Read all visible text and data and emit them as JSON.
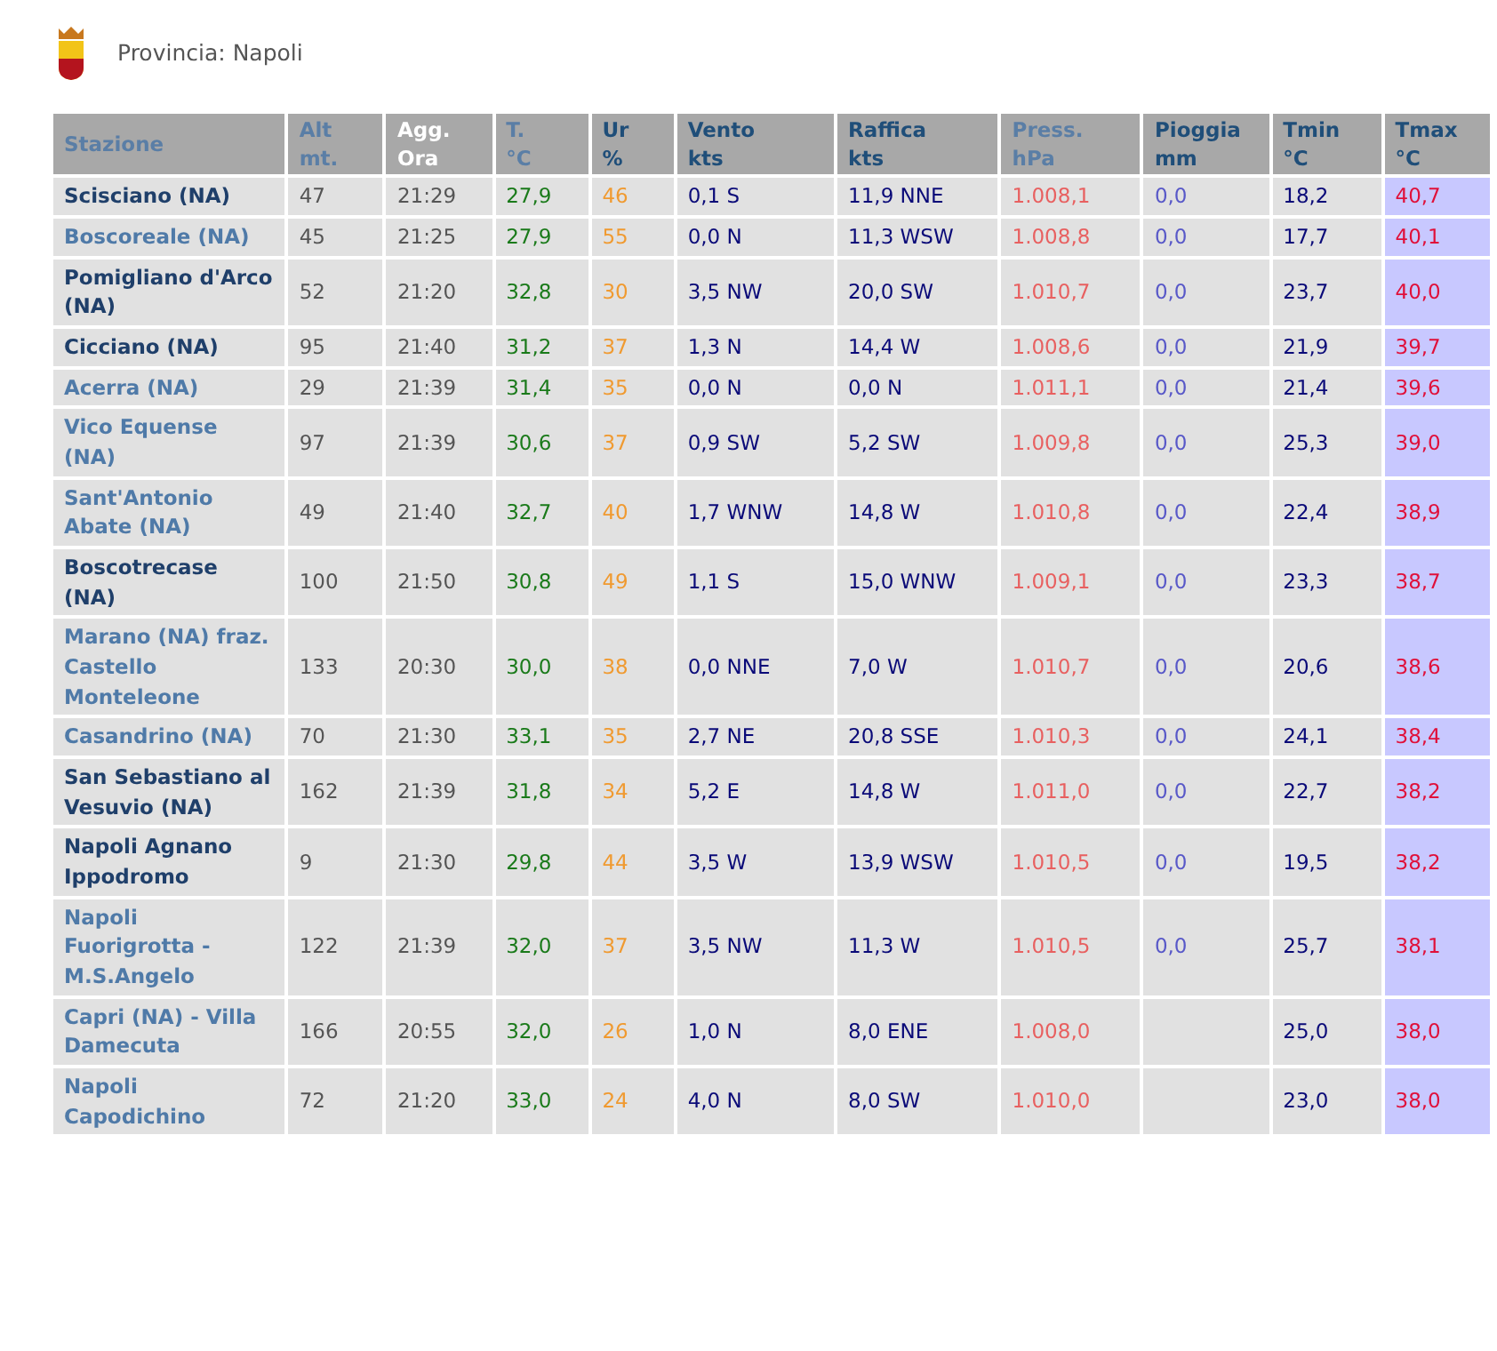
{
  "province": {
    "label": "Provincia: Napoli"
  },
  "table": {
    "columns": [
      {
        "label": "Stazione",
        "kind": "link",
        "visited": true
      },
      {
        "label": "Alt\nmt.",
        "kind": "link",
        "visited": true
      },
      {
        "label": "Agg.\nOra",
        "kind": "text"
      },
      {
        "label": "T.\n°C",
        "kind": "link",
        "visited": true
      },
      {
        "label": "Ur\n%",
        "kind": "link",
        "visited": false
      },
      {
        "label": "Vento\nkts",
        "kind": "link",
        "visited": false
      },
      {
        "label": "Raffica\nkts",
        "kind": "link",
        "visited": false
      },
      {
        "label": "Press.\nhPa",
        "kind": "link",
        "visited": true
      },
      {
        "label": "Pioggia\nmm",
        "kind": "link",
        "visited": false
      },
      {
        "label": "Tmin\n°C",
        "kind": "link",
        "visited": false
      },
      {
        "label": "Tmax\n°C",
        "kind": "link",
        "visited": false
      }
    ],
    "rows": [
      {
        "visited": false,
        "cells": [
          "Scisciano (NA)",
          "47",
          "21:29",
          "27,9",
          "46",
          "0,1 S",
          "11,9 NNE",
          "1.008,1",
          "0,0",
          "18,2",
          "40,7"
        ]
      },
      {
        "visited": true,
        "cells": [
          "Boscoreale (NA)",
          "45",
          "21:25",
          "27,9",
          "55",
          "0,0 N",
          "11,3 WSW",
          "1.008,8",
          "0,0",
          "17,7",
          "40,1"
        ]
      },
      {
        "visited": false,
        "cells": [
          "Pomigliano d'Arco (NA)",
          "52",
          "21:20",
          "32,8",
          "30",
          "3,5 NW",
          "20,0 SW",
          "1.010,7",
          "0,0",
          "23,7",
          "40,0"
        ]
      },
      {
        "visited": false,
        "cells": [
          "Cicciano (NA)",
          "95",
          "21:40",
          "31,2",
          "37",
          "1,3 N",
          "14,4 W",
          "1.008,6",
          "0,0",
          "21,9",
          "39,7"
        ]
      },
      {
        "visited": true,
        "cells": [
          "Acerra (NA)",
          "29",
          "21:39",
          "31,4",
          "35",
          "0,0 N",
          "0,0 N",
          "1.011,1",
          "0,0",
          "21,4",
          "39,6"
        ]
      },
      {
        "visited": true,
        "cells": [
          "Vico Equense (NA)",
          "97",
          "21:39",
          "30,6",
          "37",
          "0,9 SW",
          "5,2 SW",
          "1.009,8",
          "0,0",
          "25,3",
          "39,0"
        ]
      },
      {
        "visited": true,
        "cells": [
          "Sant'Antonio Abate (NA)",
          "49",
          "21:40",
          "32,7",
          "40",
          "1,7 WNW",
          "14,8 W",
          "1.010,8",
          "0,0",
          "22,4",
          "38,9"
        ]
      },
      {
        "visited": false,
        "cells": [
          "Boscotrecase (NA)",
          "100",
          "21:50",
          "30,8",
          "49",
          "1,1 S",
          "15,0 WNW",
          "1.009,1",
          "0,0",
          "23,3",
          "38,7"
        ]
      },
      {
        "visited": true,
        "cells": [
          "Marano (NA) fraz. Castello Monteleone",
          "133",
          "20:30",
          "30,0",
          "38",
          "0,0 NNE",
          "7,0 W",
          "1.010,7",
          "0,0",
          "20,6",
          "38,6"
        ]
      },
      {
        "visited": true,
        "cells": [
          "Casandrino (NA)",
          "70",
          "21:30",
          "33,1",
          "35",
          "2,7 NE",
          "20,8 SSE",
          "1.010,3",
          "0,0",
          "24,1",
          "38,4"
        ]
      },
      {
        "visited": false,
        "cells": [
          "San Sebastiano al Vesuvio (NA)",
          "162",
          "21:39",
          "31,8",
          "34",
          "5,2 E",
          "14,8 W",
          "1.011,0",
          "0,0",
          "22,7",
          "38,2"
        ]
      },
      {
        "visited": false,
        "cells": [
          "Napoli Agnano Ippodromo",
          "9",
          "21:30",
          "29,8",
          "44",
          "3,5 W",
          "13,9 WSW",
          "1.010,5",
          "0,0",
          "19,5",
          "38,2"
        ]
      },
      {
        "visited": true,
        "cells": [
          "Napoli Fuorigrotta - M.S.Angelo",
          "122",
          "21:39",
          "32,0",
          "37",
          "3,5 NW",
          "11,3 W",
          "1.010,5",
          "0,0",
          "25,7",
          "38,1"
        ]
      },
      {
        "visited": true,
        "cells": [
          "Capri (NA) - Villa Damecuta",
          "166",
          "20:55",
          "32,0",
          "26",
          "1,0 N",
          "8,0 ENE",
          "1.008,0",
          null,
          "25,0",
          "38,0"
        ]
      },
      {
        "visited": true,
        "cells": [
          "Napoli Capodichino",
          "72",
          "21:20",
          "33,0",
          "24",
          "4,0 N",
          "8,0 SW",
          "1.010,0",
          null,
          "23,0",
          "38,0"
        ]
      }
    ]
  }
}
